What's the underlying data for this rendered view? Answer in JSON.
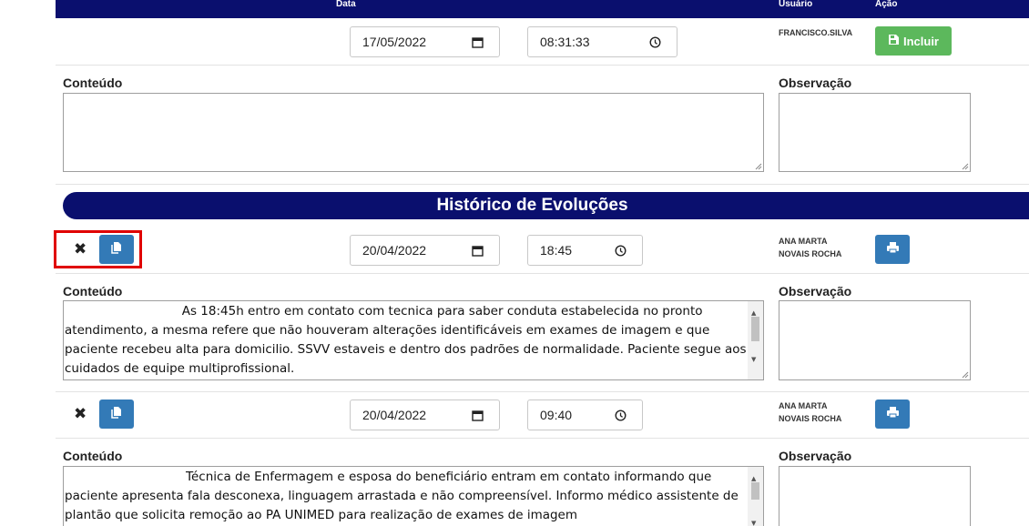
{
  "header": {
    "col_data": "Data",
    "col_user": "Usuário",
    "col_action": "Ação"
  },
  "new_entry": {
    "date": "17/05/2022",
    "time": "08:31:33",
    "user": "FRANCISCO.SILVA",
    "add_label": "Incluir",
    "content_label": "Conteúdo",
    "observation_label": "Observação",
    "content": "",
    "observation": ""
  },
  "history_title": "Histórico de Evoluções",
  "entries": [
    {
      "date": "20/04/2022",
      "time": "18:45",
      "user_line1": "ANA MARTA",
      "user_line2": "NOVAIS ROCHA",
      "content_label": "Conteúdo",
      "observation_label": "Observação",
      "content": "                              As 18:45h entro em contato com tecnica para saber conduta estabelecida no pronto atendimento, a mesma refere que não houveram alterações identificáveis em exames de imagem e que paciente recebeu alta para domicilio. SSVV estaveis e dentro dos padrões de normalidade. Paciente segue aos cuidados de equipe multiprofissional.",
      "observation": ""
    },
    {
      "date": "20/04/2022",
      "time": "09:40",
      "user_line1": "ANA MARTA",
      "user_line2": "NOVAIS ROCHA",
      "content_label": "Conteúdo",
      "observation_label": "Observação",
      "content": "                               Técnica de Enfermagem e esposa do beneficiário entram em contato informando que paciente apresenta fala desconexa, linguagem arrastada e não compreensível. Informo médico assistente de plantão que solicita remoção ao PA UNIMED para realização de exames de imagem",
      "observation": ""
    }
  ],
  "icons": {
    "calendar": "calendar-icon",
    "clock": "clock-icon",
    "add": "add-icon",
    "copy": "copy-icon",
    "print": "print-icon",
    "delete": "close-icon"
  },
  "colors": {
    "navy": "#0a0f6e",
    "green": "#5cb85c",
    "blue": "#337ab7",
    "highlight": "#e00000"
  }
}
